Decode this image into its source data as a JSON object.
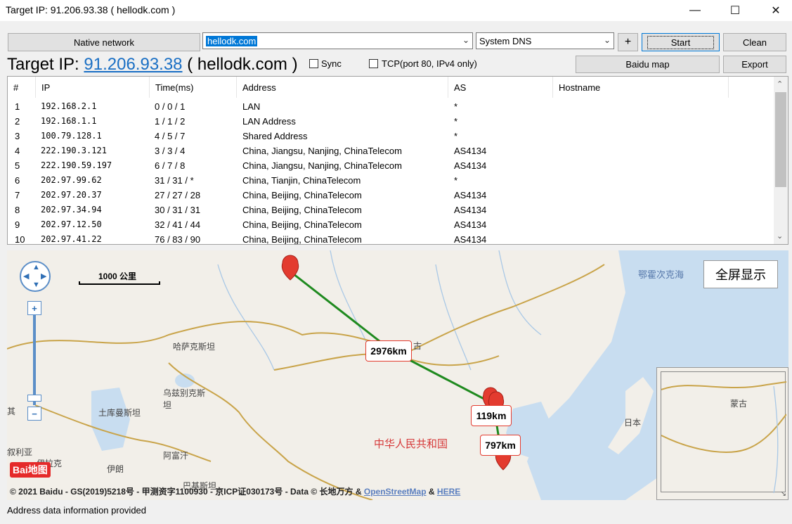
{
  "window": {
    "title": "Target IP: 91.206.93.38 ( hellodk.com )",
    "minimize": "—",
    "maximize": "☐",
    "close": "✕"
  },
  "toolbar": {
    "native_network": "Native network",
    "host_value": "hellodk.com",
    "dns_value": "System DNS",
    "plus": "+",
    "start": "Start",
    "clean": "Clean",
    "baidu_map": "Baidu map",
    "export": "Export"
  },
  "target": {
    "prefix": "Target IP: ",
    "ip": "91.206.93.38",
    "suffix": " ( hellodk.com )"
  },
  "options": {
    "sync": "Sync",
    "tcp": "TCP(port 80, IPv4 only)"
  },
  "table": {
    "headers": [
      "#",
      "IP",
      "Time(ms)",
      "Address",
      "AS",
      "Hostname"
    ],
    "rows": [
      [
        "1",
        "192.168.2.1",
        "0 / 0 / 1",
        "LAN",
        "*"
      ],
      [
        "2",
        "192.168.1.1",
        "1 / 1 / 2",
        "LAN Address",
        "*"
      ],
      [
        "3",
        "100.79.128.1",
        "4 / 5 / 7",
        "Shared Address",
        "*"
      ],
      [
        "4",
        "222.190.3.121",
        "3 / 3 / 4",
        "China, Jiangsu, Nanjing, ChinaTelecom",
        "AS4134"
      ],
      [
        "5",
        "222.190.59.197",
        "6 / 7 / 8",
        "China, Jiangsu, Nanjing, ChinaTelecom",
        "AS4134"
      ],
      [
        "6",
        "202.97.99.62",
        "31 / 31 / *",
        "China, Tianjin, ChinaTelecom",
        "*"
      ],
      [
        "7",
        "202.97.20.37",
        "27 / 27 / 28",
        "China, Beijing, ChinaTelecom",
        "AS4134"
      ],
      [
        "8",
        "202.97.34.94",
        "30 / 31 / 31",
        "China, Beijing, ChinaTelecom",
        "AS4134"
      ],
      [
        "9",
        "202.97.12.50",
        "32 / 41 / 44",
        "China, Beijing, ChinaTelecom",
        "AS4134"
      ],
      [
        "10",
        "202.97.41.22",
        "76 / 83 / 90",
        "China, Beijing, ChinaTelecom",
        "AS4134"
      ]
    ]
  },
  "map": {
    "scale": "1000 公里",
    "fullscreen": "全屏显示",
    "labels": {
      "okhotsk": "鄂霍次克海",
      "kazakhstan": "哈萨克斯坦",
      "uzbekistan": "乌兹别克斯坦",
      "turkmenistan": "土库曼斯坦",
      "afghanistan": "阿富汗",
      "iran": "伊朗",
      "syria": "叙利亚",
      "iraq": "伊拉克",
      "china": "中华人民共和国",
      "japan": "日本",
      "mongolia": "蒙古",
      "qi": "其",
      "gu": "古",
      "pakistan": "巴基斯坦"
    },
    "distances": [
      "2976km",
      "119km",
      "797km"
    ],
    "logo_text": "Bai地图",
    "copyright": "© 2021 Baidu - GS(2019)5218号 - 甲测资字1100930 - 京ICP证030173号 - Data © 长地万方 & ",
    "osm_link": "OpenStreetMap",
    "amp": " & ",
    "here_link": "HERE",
    "zoom_in": "+",
    "zoom_out": "−"
  },
  "status": "Address data information provided"
}
